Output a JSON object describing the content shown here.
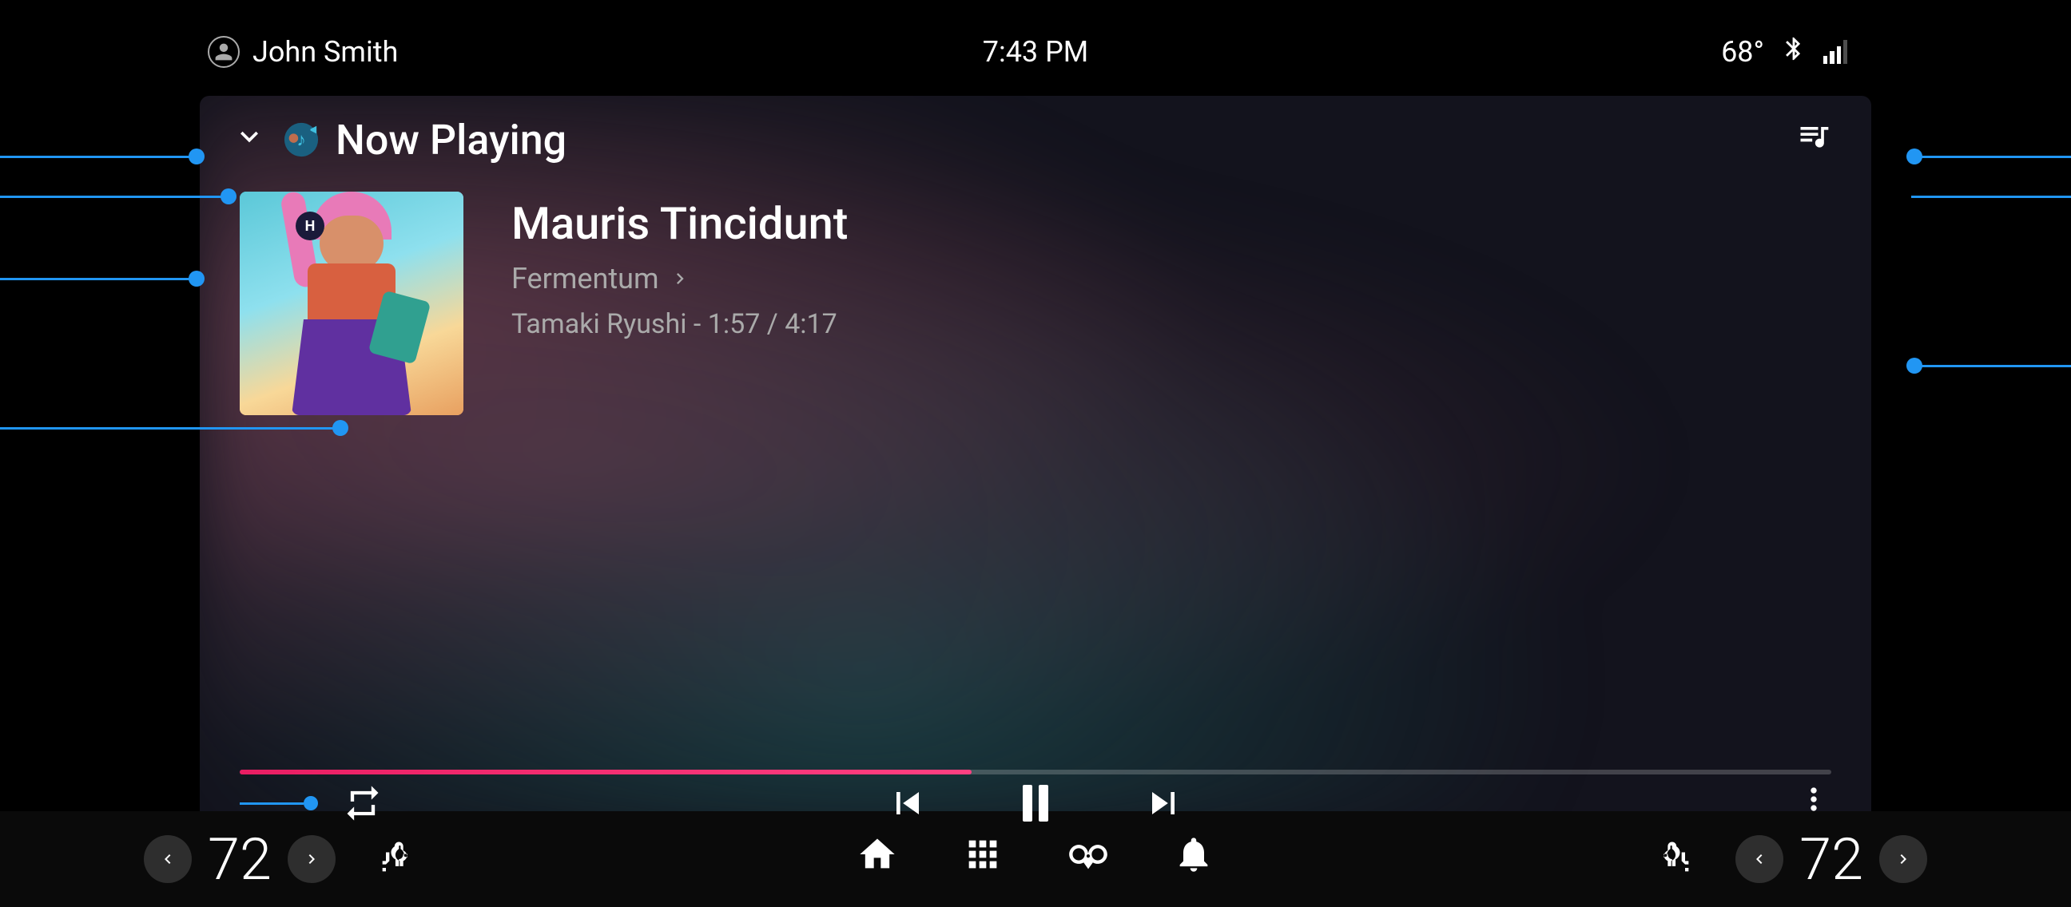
{
  "statusBar": {
    "username": "John Smith",
    "time": "7:43 PM",
    "temperature": "68°",
    "bluetooth": "bluetooth",
    "signal": "signal"
  },
  "player": {
    "header": {
      "title": "Now Playing",
      "collapseIcon": "chevron-down",
      "musicIcon": "music-note",
      "queueIcon": "queue-music"
    },
    "track": {
      "name": "Mauris Tincidunt",
      "album": "Fermentum",
      "artistTime": "Tamaki Ryushi - 1:57 / 4:17",
      "currentTime": "1:57",
      "totalTime": "4:17",
      "artist": "Tamaki Ryushi",
      "progress": 46
    },
    "controls": {
      "repeat": "repeat",
      "previous": "skip-previous",
      "pause": "pause",
      "next": "skip-next",
      "more": "more-vert"
    }
  },
  "bottomBar": {
    "leftTemp": "72",
    "rightTemp": "72",
    "navIcons": [
      "home",
      "apps",
      "fan",
      "notifications",
      "seat-heat"
    ],
    "leftDecrease": "◀",
    "leftIncrease": "▶",
    "rightDecrease": "◀",
    "rightIncrease": "▶"
  }
}
